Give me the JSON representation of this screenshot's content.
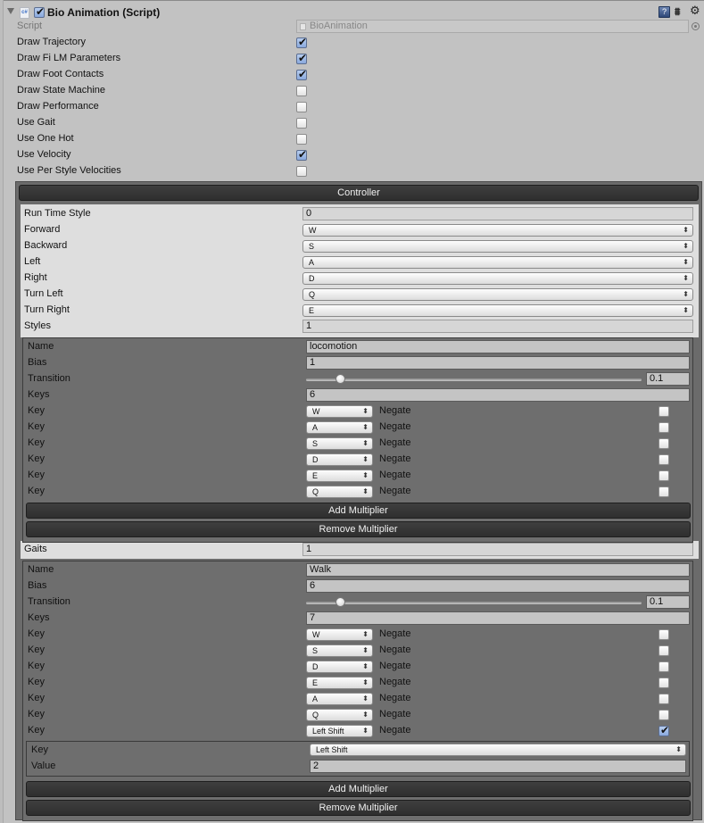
{
  "component": {
    "title": "Bio Animation (Script)",
    "enabled": true,
    "icons": [
      "foldout-arrow-icon",
      "csharp-script-icon",
      "help-book-icon",
      "preset-sliders-icon",
      "gear-menu-icon"
    ]
  },
  "script": {
    "label": "Script",
    "value": "BioAnimation"
  },
  "toggles": [
    {
      "label": "Draw Trajectory",
      "checked": true
    },
    {
      "label": "Draw Fi LM Parameters",
      "checked": true
    },
    {
      "label": "Draw Foot Contacts",
      "checked": true
    },
    {
      "label": "Draw State Machine",
      "checked": false
    },
    {
      "label": "Draw Performance",
      "checked": false
    },
    {
      "label": "Use Gait",
      "checked": false
    },
    {
      "label": "Use One Hot",
      "checked": false
    },
    {
      "label": "Use Velocity",
      "checked": true
    },
    {
      "label": "Use Per Style Velocities",
      "checked": false
    }
  ],
  "controller": {
    "header_label": "Controller",
    "run_time_style": {
      "label": "Run Time Style",
      "value": "0"
    },
    "keys": [
      {
        "label": "Forward",
        "value": "W"
      },
      {
        "label": "Backward",
        "value": "S"
      },
      {
        "label": "Left",
        "value": "A"
      },
      {
        "label": "Right",
        "value": "D"
      },
      {
        "label": "Turn Left",
        "value": "Q"
      },
      {
        "label": "Turn Right",
        "value": "E"
      }
    ],
    "styles": {
      "label": "Styles",
      "count": "1",
      "items": [
        {
          "name_label": "Name",
          "name": "locomotion",
          "bias_label": "Bias",
          "bias": "1",
          "transition_label": "Transition",
          "transition": "0.1",
          "transition_fraction": 0.1,
          "keys_label": "Keys",
          "keys_count": "6",
          "key_label": "Key",
          "negate_label": "Negate",
          "keys": [
            {
              "key": "W",
              "negate": false
            },
            {
              "key": "A",
              "negate": false
            },
            {
              "key": "S",
              "negate": false
            },
            {
              "key": "D",
              "negate": false
            },
            {
              "key": "E",
              "negate": false
            },
            {
              "key": "Q",
              "negate": false
            }
          ],
          "add_multiplier": "Add Multiplier",
          "remove_multiplier": "Remove Multiplier"
        }
      ]
    },
    "gaits": {
      "label": "Gaits",
      "count": "1",
      "items": [
        {
          "name_label": "Name",
          "name": "Walk",
          "bias_label": "Bias",
          "bias": "6",
          "transition_label": "Transition",
          "transition": "0.1",
          "transition_fraction": 0.1,
          "keys_label": "Keys",
          "keys_count": "7",
          "key_label": "Key",
          "negate_label": "Negate",
          "keys": [
            {
              "key": "W",
              "negate": false
            },
            {
              "key": "S",
              "negate": false
            },
            {
              "key": "D",
              "negate": false
            },
            {
              "key": "E",
              "negate": false
            },
            {
              "key": "A",
              "negate": false
            },
            {
              "key": "Q",
              "negate": false
            },
            {
              "key": "Left Shift",
              "negate": true
            }
          ],
          "multiplier": {
            "key_label": "Key",
            "key": "Left Shift",
            "value_label": "Value",
            "value": "2"
          },
          "add_multiplier": "Add Multiplier",
          "remove_multiplier": "Remove Multiplier"
        }
      ]
    }
  }
}
